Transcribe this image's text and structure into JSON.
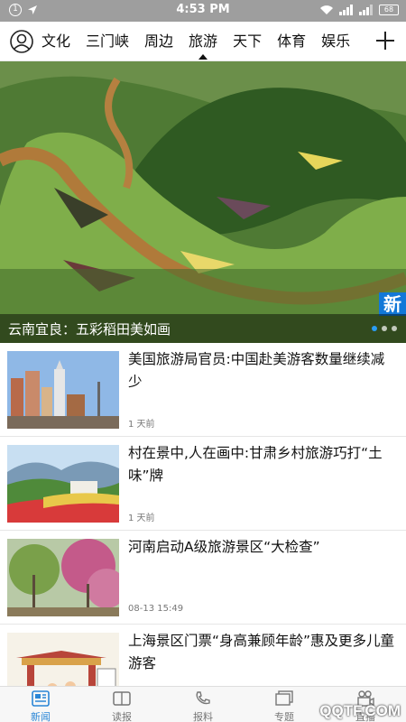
{
  "status_bar": {
    "notification_count": "1",
    "time": "4:53 PM",
    "battery": "68"
  },
  "tabs": [
    {
      "label": "文化",
      "active": false
    },
    {
      "label": "三门峡",
      "active": false
    },
    {
      "label": "周边",
      "active": false
    },
    {
      "label": "旅游",
      "active": true
    },
    {
      "label": "天下",
      "active": false
    },
    {
      "label": "体育",
      "active": false
    },
    {
      "label": "娱乐",
      "active": false
    }
  ],
  "banner": {
    "title": "云南宜良：五彩稻田美如画",
    "corner_badge": "新",
    "dots_count": 3,
    "active_dot": 0
  },
  "news": [
    {
      "title": "美国旅游局官员:中国赴美游客数量继续减少",
      "time": "1 天前"
    },
    {
      "title": "村在景中,人在画中:甘肃乡村旅游巧打“土味”牌",
      "time": "1 天前"
    },
    {
      "title": "河南启动A级旅游景区“大检查”",
      "time": "08-13 15:49"
    },
    {
      "title": "上海景区门票“身高兼顾年龄”惠及更多儿童游客",
      "time": ""
    }
  ],
  "bottom_nav": [
    {
      "label": "新闻",
      "icon": "news-icon",
      "active": true
    },
    {
      "label": "读报",
      "icon": "newspaper-icon",
      "active": false
    },
    {
      "label": "报料",
      "icon": "phone-icon",
      "active": false
    },
    {
      "label": "专题",
      "icon": "topics-icon",
      "active": false
    },
    {
      "label": "直播",
      "icon": "live-camera-icon",
      "active": false
    }
  ],
  "watermark": "QQTF.COM",
  "colors": {
    "accent": "#2a86d6",
    "status_bar": "#9e9e9e"
  }
}
